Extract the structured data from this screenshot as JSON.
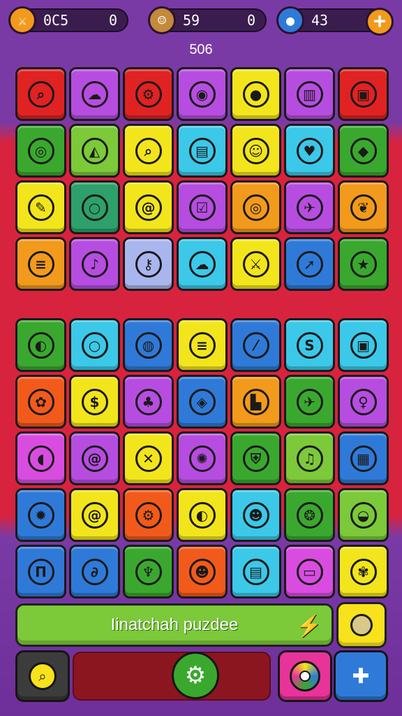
{
  "hud": {
    "left": {
      "icon": "swords-icon",
      "value_a": "0C5",
      "value_b": "0"
    },
    "center": {
      "icon": "character-portrait-icon",
      "value_a": "59",
      "value_b": "0"
    },
    "right": {
      "icon": "blue-orb-icon",
      "value_a": "43",
      "add_icon": "plus-icon"
    }
  },
  "score": "506",
  "board_top": [
    [
      {
        "color": "#e02222",
        "icon": "magnifier-icon"
      },
      {
        "color": "#b64de0",
        "icon": "cloud-icon"
      },
      {
        "color": "#e02222",
        "icon": "gear-icon"
      },
      {
        "color": "#b64de0",
        "icon": "potion-icon"
      },
      {
        "color": "#f2e51c",
        "icon": "bomb-icon"
      },
      {
        "color": "#b64de0",
        "icon": "chest-icon"
      },
      {
        "color": "#e02222",
        "icon": "robot-face-icon"
      }
    ],
    [
      {
        "color": "#3aa82e",
        "icon": "donut-icon"
      },
      {
        "color": "#7cc93a",
        "icon": "shoe-icon"
      },
      {
        "color": "#f2e51c",
        "icon": "magnifier-icon"
      },
      {
        "color": "#3cc8e8",
        "icon": "box-icon"
      },
      {
        "color": "#f2e51c",
        "icon": "smiley-icon"
      },
      {
        "color": "#3cc8e8",
        "icon": "heart-shape-icon"
      },
      {
        "color": "#3aa82e",
        "icon": "candy-icon"
      }
    ],
    [
      {
        "color": "#f2e51c",
        "icon": "pencil-icon"
      },
      {
        "color": "#2ea06a",
        "icon": "ring-icon"
      },
      {
        "color": "#f2e51c",
        "icon": "swirl-icon"
      },
      {
        "color": "#b64de0",
        "icon": "check-box-icon"
      },
      {
        "color": "#f29a1c",
        "icon": "target-icon"
      },
      {
        "color": "#b64de0",
        "icon": "bird-icon"
      },
      {
        "color": "#f29a1c",
        "icon": "leaf-coin-icon"
      }
    ],
    [
      {
        "color": "#f29a1c",
        "icon": "burger-icon"
      },
      {
        "color": "#b64de0",
        "icon": "note-icon"
      },
      {
        "color": "#a9b6ee",
        "icon": "key-icon"
      },
      {
        "color": "#3cc8e8",
        "icon": "cloud-icon"
      },
      {
        "color": "#f2e51c",
        "icon": "sword-icon"
      },
      {
        "color": "#2f7ad8",
        "icon": "rocket-icon"
      },
      {
        "color": "#3aa82e",
        "icon": "star-icon"
      }
    ]
  ],
  "board_bottom": [
    [
      {
        "color": "#3aa82e",
        "icon": "chat-bubble-icon"
      },
      {
        "color": "#3cc8e8",
        "icon": "ring-icon"
      },
      {
        "color": "#2f7ad8",
        "icon": "egg-icon"
      },
      {
        "color": "#f2e51c",
        "icon": "burger-icon"
      },
      {
        "color": "#2f7ad8",
        "icon": "chili-icon"
      },
      {
        "color": "#3cc8e8",
        "icon": "s-card-icon"
      },
      {
        "color": "#3cc8e8",
        "icon": "robot-face-icon"
      }
    ],
    [
      {
        "color": "#f25a1c",
        "icon": "leaf-icon"
      },
      {
        "color": "#f2e51c",
        "icon": "coin-icon"
      },
      {
        "color": "#b64de0",
        "icon": "tree-icon"
      },
      {
        "color": "#2f7ad8",
        "icon": "lemon-icon"
      },
      {
        "color": "#f29a1c",
        "icon": "tower-icon"
      },
      {
        "color": "#3aa82e",
        "icon": "plane-icon"
      },
      {
        "color": "#b64de0",
        "icon": "bulb-icon"
      }
    ],
    [
      {
        "color": "#d84de0",
        "icon": "bean-icon"
      },
      {
        "color": "#b64de0",
        "icon": "spiral-icon"
      },
      {
        "color": "#f2e51c",
        "icon": "crossed-swords-icon"
      },
      {
        "color": "#b64de0",
        "icon": "ribbon-icon"
      },
      {
        "color": "#3aa82e",
        "icon": "shield-icon"
      },
      {
        "color": "#7cc93a",
        "icon": "bell-icon"
      },
      {
        "color": "#2f7ad8",
        "icon": "building-icon"
      }
    ],
    [
      {
        "color": "#2f7ad8",
        "icon": "sun-gear-icon"
      },
      {
        "color": "#f2e51c",
        "icon": "spiral-icon"
      },
      {
        "color": "#f25a1c",
        "icon": "gear-icon"
      },
      {
        "color": "#f2e51c",
        "icon": "chat-bubble-icon"
      },
      {
        "color": "#3cc8e8",
        "icon": "monster-icon"
      },
      {
        "color": "#3aa82e",
        "icon": "lion-icon"
      },
      {
        "color": "#7cc93a",
        "icon": "bowl-icon"
      }
    ],
    [
      {
        "color": "#2f7ad8",
        "icon": "column-icon"
      },
      {
        "color": "#2f7ad8",
        "icon": "snake-icon"
      },
      {
        "color": "#3aa82e",
        "icon": "leaf-cup-icon"
      },
      {
        "color": "#f25a1c",
        "icon": "face-icon"
      },
      {
        "color": "#3cc8e8",
        "icon": "clipboard-icon"
      },
      {
        "color": "#d84de0",
        "icon": "tv-icon"
      },
      {
        "color": "#f2e51c",
        "icon": "flower-icon"
      }
    ]
  ],
  "banner": {
    "label": "Iinatchah puzdee",
    "icon": "lightning-icon"
  },
  "side_tile": {
    "icon": "coin-icon"
  },
  "bottom": {
    "search_icon": "magnifier-icon",
    "gear_icon": "gear-icon",
    "target_icon": "color-wheel-icon",
    "bone_icon": "bone-icon"
  }
}
